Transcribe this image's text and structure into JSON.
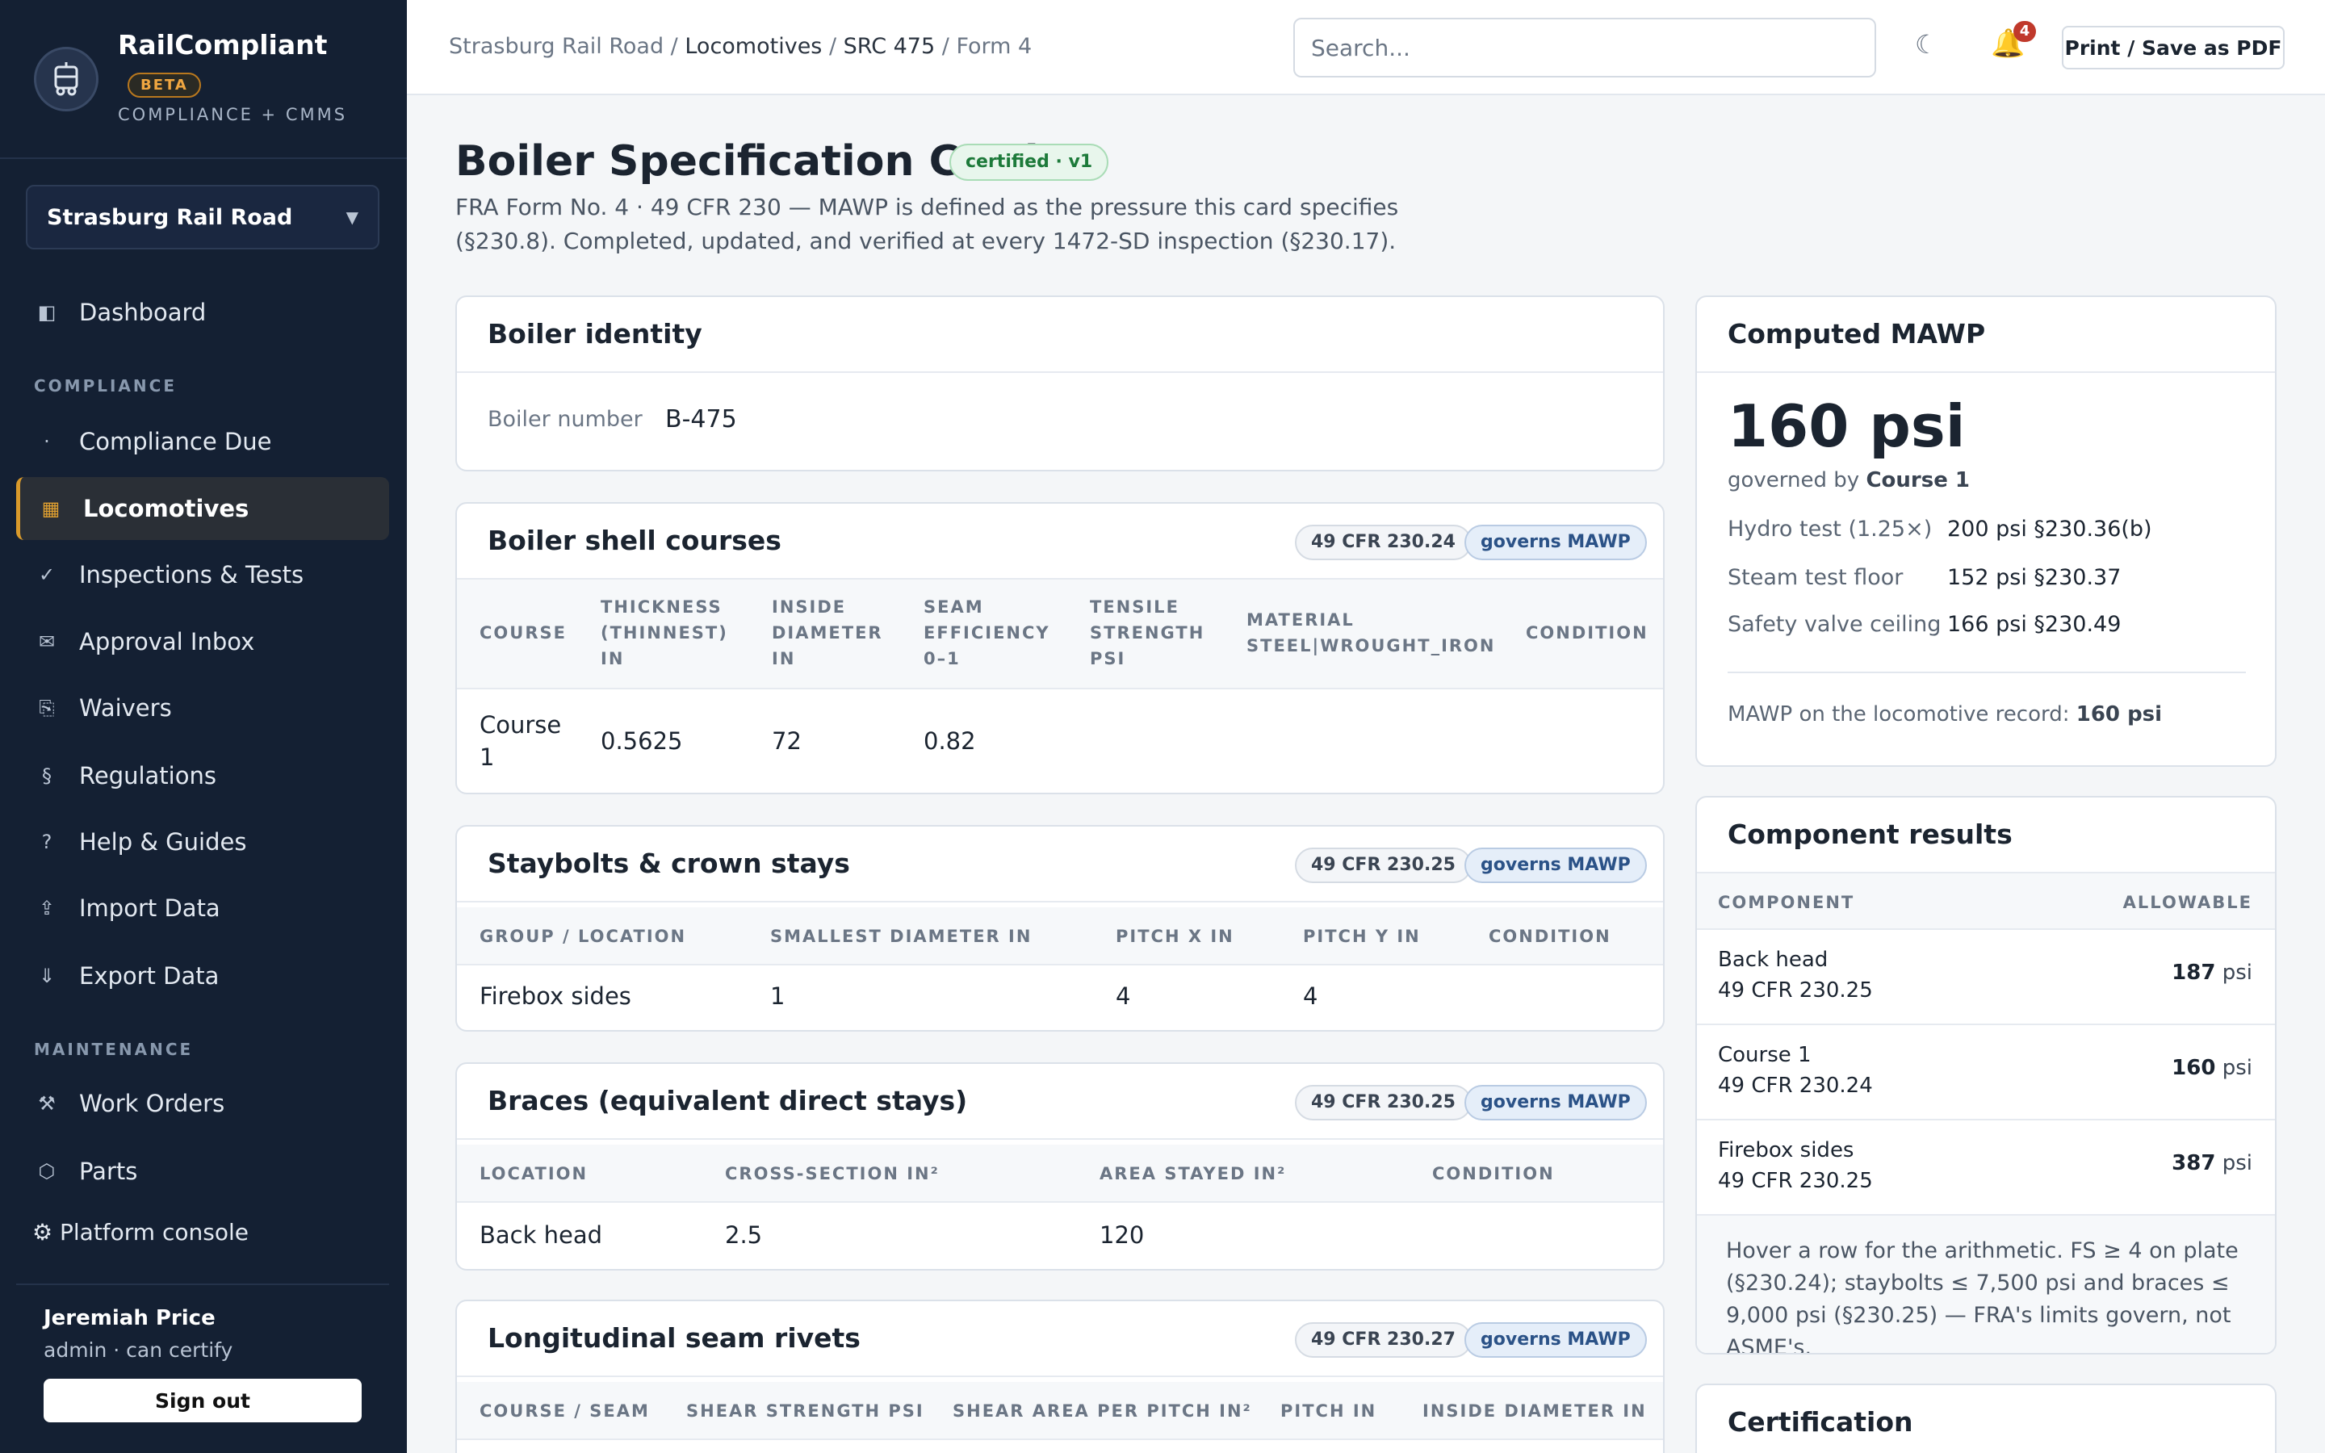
{
  "brand": {
    "name": "RailCompliant",
    "badge": "BETA",
    "subtitle": "COMPLIANCE + CMMS"
  },
  "org": {
    "name": "Strasburg Rail Road"
  },
  "nav": {
    "dashboard": "Dashboard",
    "compliance_section": "COMPLIANCE",
    "compliance_due": "Compliance Due",
    "locomotives": "Locomotives",
    "inspections": "Inspections & Tests",
    "approval_inbox": "Approval Inbox",
    "waivers": "Waivers",
    "regulations": "Regulations",
    "help": "Help & Guides",
    "import": "Import Data",
    "export": "Export Data",
    "maintenance_section": "MAINTENANCE",
    "work_orders": "Work Orders",
    "parts": "Parts",
    "platform_console": "⚙ Platform console"
  },
  "user": {
    "name": "Jeremiah Price",
    "role": "admin · can certify",
    "signout": "Sign out"
  },
  "topbar": {
    "breadcrumb": [
      "Strasburg Rail Road",
      "Locomotives",
      "SRC 475",
      "Form 4"
    ],
    "separator": " / ",
    "search_placeholder": "Search...",
    "notif_count": "4",
    "print_label": "Print / Save as PDF"
  },
  "page": {
    "title": "Boiler Specification Card",
    "badge": "certified · v1",
    "subtitle": "FRA Form No. 4 · 49 CFR 230 — MAWP is defined as the pressure this card specifies (§230.8). Completed, updated, and verified at every 1472-SD inspection (§230.17)."
  },
  "identity": {
    "title": "Boiler identity",
    "label": "Boiler number",
    "value": "B-475"
  },
  "shell": {
    "title": "Boiler shell courses",
    "cfr": "49 CFR 230.24",
    "gov": "governs MAWP",
    "headers": [
      "COURSE",
      "THICKNESS (THINNEST) IN",
      "INSIDE DIAMETER IN",
      "SEAM EFFICIENCY 0–1",
      "TENSILE STRENGTH PSI",
      "MATERIAL STEEL|WROUGHT_IRON",
      "CONDITION"
    ],
    "rows": [
      [
        "Course 1",
        "0.5625",
        "72",
        "0.82",
        "",
        "",
        ""
      ]
    ]
  },
  "staybolts": {
    "title": "Staybolts & crown stays",
    "cfr": "49 CFR 230.25",
    "gov": "governs MAWP",
    "headers": [
      "GROUP / LOCATION",
      "SMALLEST DIAMETER IN",
      "PITCH X IN",
      "PITCH Y IN",
      "CONDITION"
    ],
    "rows": [
      [
        "Firebox sides",
        "1",
        "4",
        "4",
        ""
      ]
    ]
  },
  "braces": {
    "title": "Braces (equivalent direct stays)",
    "cfr": "49 CFR 230.25",
    "gov": "governs MAWP",
    "headers": [
      "LOCATION",
      "CROSS-SECTION IN²",
      "AREA STAYED IN²",
      "CONDITION"
    ],
    "rows": [
      [
        "Back head",
        "2.5",
        "120",
        ""
      ]
    ]
  },
  "rivets": {
    "title": "Longitudinal seam rivets",
    "cfr": "49 CFR 230.27",
    "gov": "governs MAWP",
    "headers": [
      "COURSE / SEAM",
      "SHEAR STRENGTH PSI",
      "SHEAR AREA PER PITCH IN²",
      "PITCH IN",
      "INSIDE DIAMETER IN"
    ]
  },
  "mawp": {
    "title": "Computed MAWP",
    "value": "160 psi",
    "governed_prefix": "governed by ",
    "governed_by": "Course 1",
    "rows": [
      {
        "label": "Hydro test (1.25×)",
        "value": "200 psi §230.36(b)"
      },
      {
        "label": "Steam test floor",
        "value": "152 psi §230.37"
      },
      {
        "label": "Safety valve ceiling",
        "value": "166 psi §230.49"
      }
    ],
    "record_prefix": "MAWP on the locomotive record: ",
    "record_value": "160 psi"
  },
  "components": {
    "title": "Component results",
    "headers": [
      "COMPONENT",
      "ALLOWABLE"
    ],
    "unit": " psi",
    "rows": [
      {
        "name": "Back head",
        "cfr": "49 CFR 230.25",
        "value": "187"
      },
      {
        "name": "Course 1",
        "cfr": "49 CFR 230.24",
        "value": "160"
      },
      {
        "name": "Firebox sides",
        "cfr": "49 CFR 230.25",
        "value": "387"
      }
    ],
    "note": "Hover a row for the arithmetic. FS ≥ 4 on plate (§230.24); staybolts ≤ 7,500 psi and braces ≤ 9,000 psi (§230.25) — FRA's limits govern, not ASME's."
  },
  "certification": {
    "title": "Certification"
  },
  "colors": {
    "sidebar": "#142033",
    "accent": "#d99a2b",
    "governs": "#2b5287",
    "certified": "#1d7a3a"
  },
  "icons": {
    "logo": "locomotive-icon",
    "dashboard": "dashboard-icon",
    "compliance_due": "dot-icon",
    "locomotives": "grid-icon",
    "inspections": "check-icon",
    "approval": "envelope-icon",
    "waivers": "document-icon",
    "regulations": "section-icon",
    "help": "question-icon",
    "import": "upload-icon",
    "export": "download-icon",
    "work_orders": "tools-icon",
    "parts": "hexagon-icon",
    "theme": "moon-icon",
    "notifications": "bell-icon"
  }
}
